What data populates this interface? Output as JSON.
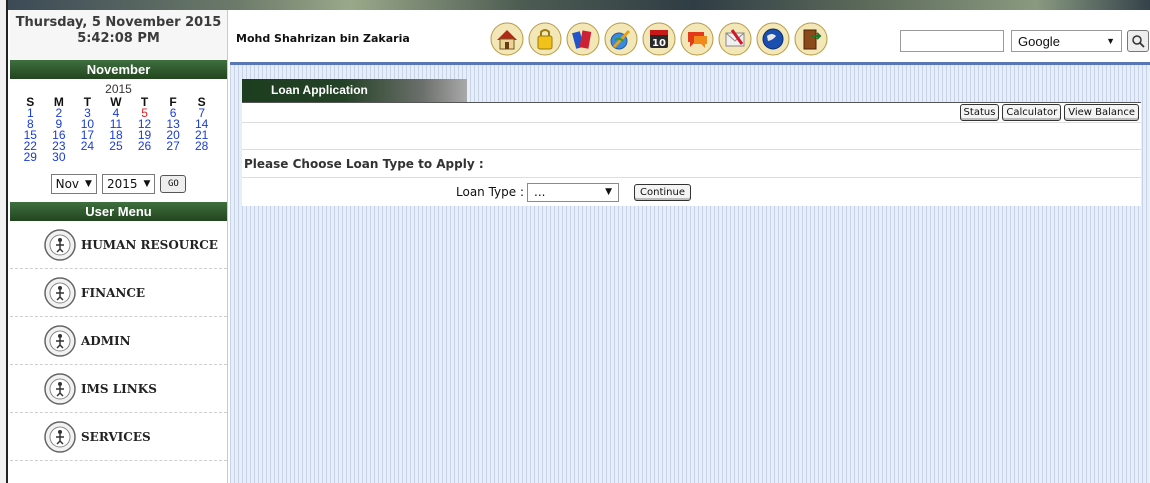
{
  "datetime": {
    "date": "Thursday, 5 November 2015",
    "time": "5:42:08 PM"
  },
  "calendar": {
    "month_title": "November",
    "year": "2015",
    "weekdays": [
      "S",
      "M",
      "T",
      "W",
      "T",
      "F",
      "S"
    ],
    "weeks": [
      [
        "1",
        "2",
        "3",
        "4",
        "5",
        "6",
        "7"
      ],
      [
        "8",
        "9",
        "10",
        "11",
        "12",
        "13",
        "14"
      ],
      [
        "15",
        "16",
        "17",
        "18",
        "19",
        "20",
        "21"
      ],
      [
        "22",
        "23",
        "24",
        "25",
        "26",
        "27",
        "28"
      ],
      [
        "29",
        "30",
        "",
        "",
        "",
        "",
        ""
      ]
    ],
    "month_select": "Nov",
    "year_select": "2015",
    "go_label": "GO"
  },
  "menu": {
    "title": "User Menu",
    "items": [
      "HUMAN RESOURCE",
      "FINANCE",
      "ADMIN",
      "IMS LINKS",
      "SERVICES"
    ]
  },
  "header": {
    "user_name": "Mohd Shahrizan bin Zakaria",
    "toolbar_icons": [
      "home-icon",
      "locker-icon",
      "books-icon",
      "pencil-globe-icon",
      "calendar-icon",
      "chat-icon",
      "mail-icon",
      "globe-icon",
      "exit-door-icon"
    ],
    "calendar_icon_text": "10",
    "search_value": "",
    "search_engine": "Google"
  },
  "content": {
    "tab_title": "Loan Application",
    "buttons": {
      "status": "Status",
      "calculator": "Calculator",
      "view_balance": "View Balance"
    },
    "heading": "Please Choose Loan Type to Apply :",
    "loan_type_label": "Loan Type :",
    "loan_type_value": "...",
    "continue_label": "Continue"
  }
}
